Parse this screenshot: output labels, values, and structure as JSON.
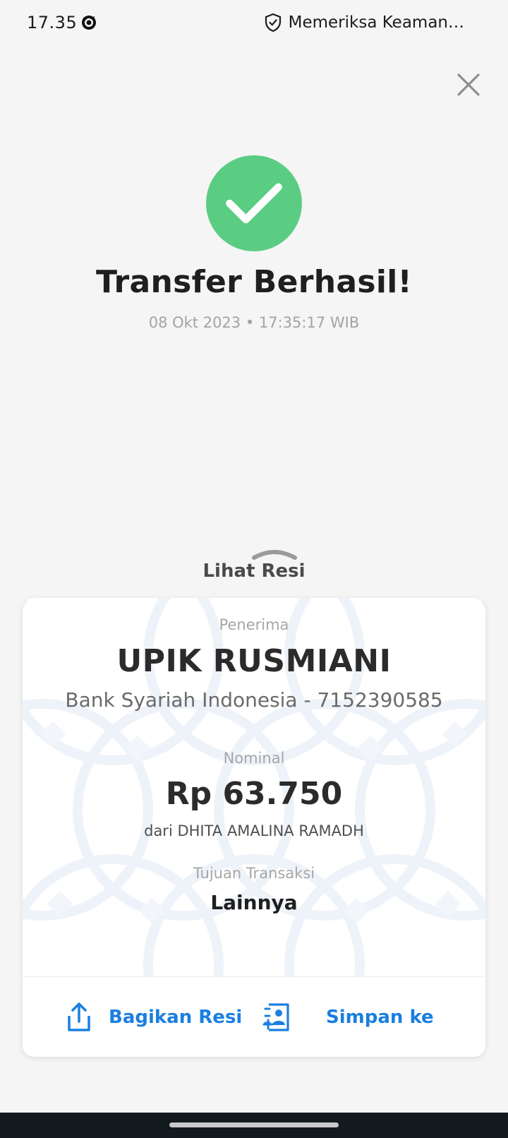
{
  "status_bar": {
    "time": "17.35",
    "security_text": "Memeriksa Keaman…"
  },
  "header": {
    "close_icon": "close-icon"
  },
  "success": {
    "icon": "check-icon",
    "icon_color": "#5acd83",
    "title": "Transfer Berhasil!",
    "datetime": "08 Okt 2023 • 17:35:17 WIB"
  },
  "receipt": {
    "toggle_label": "Lihat Resi",
    "recipient_label": "Penerima",
    "recipient_name": "UPIK RUSMIANI",
    "recipient_bank": "Bank Syariah Indonesia - 7152390585",
    "amount_label": "Nominal",
    "amount": "Rp 63.750",
    "sender": "dari DHITA AMALINA RAMADH",
    "purpose_label": "Tujuan Transaksi",
    "purpose": "Lainnya",
    "share_label": "Bagikan Resi",
    "save_label": "Simpan ke",
    "accent_color": "#1a7fe0"
  }
}
